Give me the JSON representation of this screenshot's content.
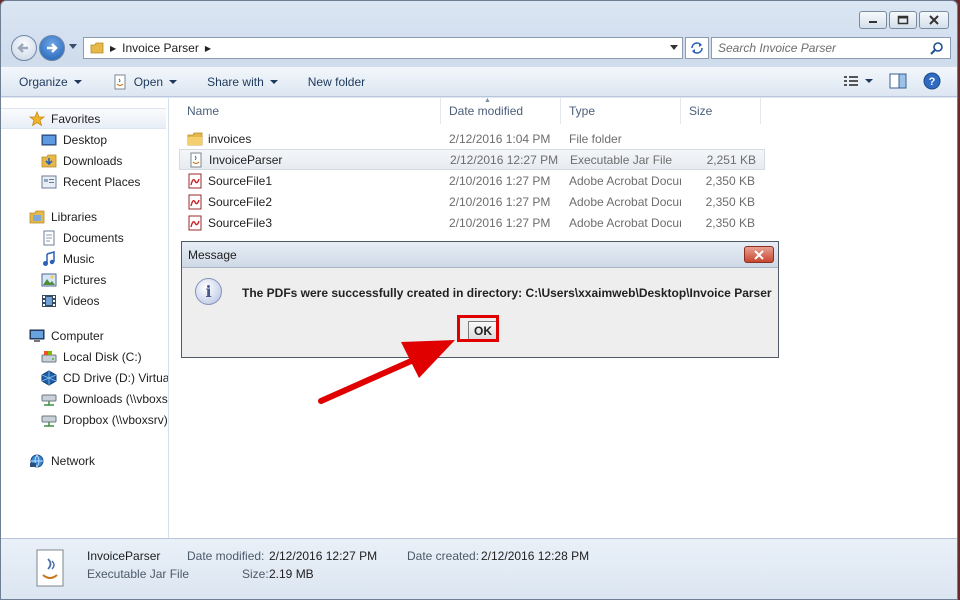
{
  "window": {
    "address": {
      "folder": "Invoice Parser"
    },
    "search": {
      "placeholder": "Search Invoice Parser"
    },
    "toolbar": {
      "organize": "Organize",
      "open": "Open",
      "share_with": "Share with",
      "new_folder": "New folder"
    },
    "sidebar": {
      "favorites": {
        "label": "Favorites",
        "items": [
          "Desktop",
          "Downloads",
          "Recent Places"
        ]
      },
      "libraries": {
        "label": "Libraries",
        "items": [
          "Documents",
          "Music",
          "Pictures",
          "Videos"
        ]
      },
      "computer": {
        "label": "Computer",
        "items": [
          "Local Disk (C:)",
          "CD Drive (D:) VirtualBox Guest Additions",
          "Downloads (\\\\vboxsrv)",
          "Dropbox (\\\\vboxsrv)"
        ]
      },
      "network": {
        "label": "Network"
      }
    },
    "columns": {
      "name": "Name",
      "date": "Date modified",
      "type": "Type",
      "size": "Size"
    },
    "files": [
      {
        "name": "invoices",
        "date": "2/12/2016 1:04 PM",
        "type": "File folder",
        "size": "",
        "icon": "folder-icon"
      },
      {
        "name": "InvoiceParser",
        "date": "2/12/2016 12:27 PM",
        "type": "Executable Jar File",
        "size": "2,251 KB",
        "icon": "jar-file-icon"
      },
      {
        "name": "SourceFile1",
        "date": "2/10/2016 1:27 PM",
        "type": "Adobe Acrobat Document",
        "size": "2,350 KB",
        "icon": "pdf-icon"
      },
      {
        "name": "SourceFile2",
        "date": "2/10/2016 1:27 PM",
        "type": "Adobe Acrobat Document",
        "size": "2,350 KB",
        "icon": "pdf-icon"
      },
      {
        "name": "SourceFile3",
        "date": "2/10/2016 1:27 PM",
        "type": "Adobe Acrobat Document",
        "size": "2,350 KB",
        "icon": "pdf-icon"
      }
    ],
    "details": {
      "name": "InvoiceParser",
      "type": "Executable Jar File",
      "date_modified_label": "Date modified:",
      "date_modified": "2/12/2016 12:27 PM",
      "date_created_label": "Date created:",
      "date_created": "2/12/2016 12:28 PM",
      "size_label": "Size:",
      "size": "2.19 MB"
    }
  },
  "dialog": {
    "title": "Message",
    "message": "The PDFs were successfully created in directory: C:\\Users\\xxaimweb\\Desktop\\Invoice Parser",
    "ok_label": "OK"
  },
  "colors": {
    "highlight": "#e00000",
    "arrow": "#e00000",
    "selection": "#e7ebf0"
  }
}
